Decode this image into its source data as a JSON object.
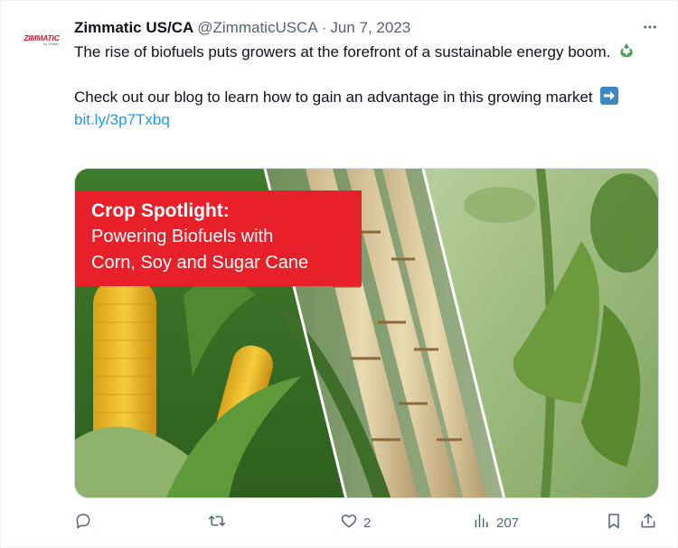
{
  "tweet": {
    "author_name": "Zimmatic US/CA",
    "handle": "@ZimmaticUSCA",
    "separator": "·",
    "date": "Jun 7, 2023",
    "avatar_logo": "ZIMMATIC",
    "avatar_sub": "by Lindsay",
    "line1": "The rise of biofuels puts growers at the forefront of a sustainable energy boom.",
    "line1_emoji": "recycle-icon",
    "line2": "Check out our blog to learn how to gain an advantage in this growing market",
    "line2_emoji": "right-arrow-icon",
    "link": "bit.ly/3p7Txbq"
  },
  "media": {
    "banner_title": "Crop Spotlight:",
    "banner_line1": "Powering Biofuels with",
    "banner_line2": "Corn, Soy and Sugar Cane",
    "banner_color": "#e8202a",
    "panels": [
      "corn",
      "sugar cane",
      "soybean pods"
    ]
  },
  "actions": {
    "reply": {
      "icon": "reply-icon",
      "count": ""
    },
    "retweet": {
      "icon": "retweet-icon",
      "count": ""
    },
    "like": {
      "icon": "heart-icon",
      "count": "2"
    },
    "views": {
      "icon": "views-icon",
      "count": "207"
    },
    "bookmark": {
      "icon": "bookmark-icon"
    },
    "share": {
      "icon": "share-icon"
    }
  },
  "colors": {
    "text_primary": "#0f1419",
    "text_secondary": "#536471",
    "link": "#1d9bf0",
    "brand_red": "#d3182c"
  }
}
